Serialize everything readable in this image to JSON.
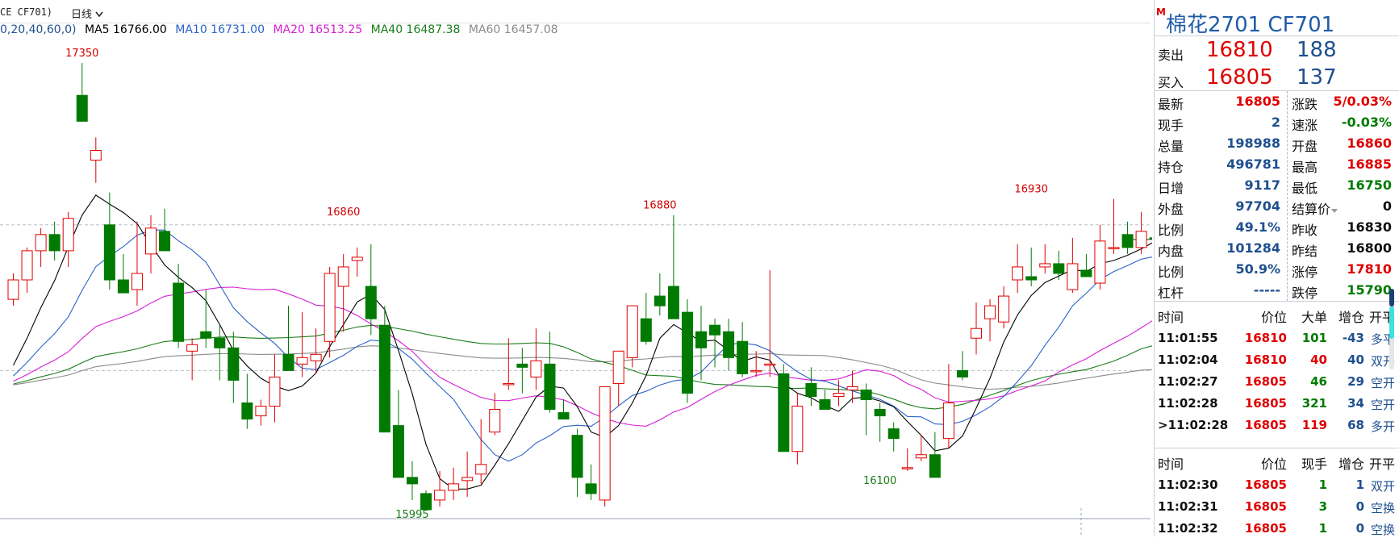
{
  "header": {
    "symbol_partial": "CE CF701)",
    "period": "日线",
    "period_icon": "chevron-down-icon"
  },
  "ma_legend": {
    "params": "0,20,40,60,0)",
    "items": [
      {
        "label": "MA5 16766.00",
        "color": "#000000"
      },
      {
        "label": "MA10 16731.00",
        "color": "#2a63c7"
      },
      {
        "label": "MA20 16513.25",
        "color": "#d61fd6"
      },
      {
        "label": "MA40 16487.38",
        "color": "#1a7d1a"
      },
      {
        "label": "MA60 16457.08",
        "color": "#8a8a8a"
      }
    ]
  },
  "chart_data": {
    "type": "candlestick",
    "title": "",
    "ylim": [
      15950,
      17420
    ],
    "reference_lines": [
      16850,
      16400
    ],
    "colors": {
      "up": "#e00000",
      "down": "#007a00",
      "ma5": "#000000",
      "ma10": "#2a63c7",
      "ma20": "#d61fd6",
      "ma40": "#1a7d1a",
      "ma60": "#8a8a8a"
    },
    "annotations": [
      {
        "text": "17350",
        "index": 5,
        "value": 17350,
        "color": "#d10000"
      },
      {
        "text": "16860",
        "index": 24,
        "value": 16860,
        "color": "#d10000"
      },
      {
        "text": "16880",
        "index": 47,
        "value": 16880,
        "color": "#d10000"
      },
      {
        "text": "15995",
        "index": 29,
        "value": 15995,
        "color": "#1a7d1a"
      },
      {
        "text": "16100",
        "index": 63,
        "value": 16100,
        "color": "#1a7d1a"
      },
      {
        "text": "16930",
        "index": 74,
        "value": 16930,
        "color": "#d10000"
      }
    ],
    "candles": [
      [
        16620,
        16700,
        16600,
        16680
      ],
      [
        16680,
        16780,
        16640,
        16770
      ],
      [
        16770,
        16840,
        16720,
        16820
      ],
      [
        16820,
        16860,
        16740,
        16770
      ],
      [
        16770,
        16890,
        16720,
        16870
      ],
      [
        17250,
        17350,
        17200,
        17170
      ],
      [
        17050,
        17120,
        16980,
        17080
      ],
      [
        16850,
        16950,
        16650,
        16680
      ],
      [
        16680,
        16760,
        16640,
        16640
      ],
      [
        16650,
        16860,
        16600,
        16700
      ],
      [
        16760,
        16880,
        16700,
        16840
      ],
      [
        16830,
        16900,
        16780,
        16770
      ],
      [
        16670,
        16730,
        16470,
        16490
      ],
      [
        16460,
        16500,
        16370,
        16480
      ],
      [
        16520,
        16650,
        16470,
        16500
      ],
      [
        16500,
        16540,
        16370,
        16470
      ],
      [
        16470,
        16520,
        16300,
        16370
      ],
      [
        16300,
        16390,
        16220,
        16250
      ],
      [
        16260,
        16310,
        16230,
        16290
      ],
      [
        16290,
        16450,
        16240,
        16380
      ],
      [
        16450,
        16600,
        16400,
        16400
      ],
      [
        16420,
        16580,
        16380,
        16440
      ],
      [
        16430,
        16530,
        16390,
        16450
      ],
      [
        16490,
        16720,
        16440,
        16700
      ],
      [
        16660,
        16760,
        16520,
        16720
      ],
      [
        16740,
        16780,
        16690,
        16750
      ],
      [
        16660,
        16790,
        16510,
        16560
      ],
      [
        16540,
        16600,
        16210,
        16210
      ],
      [
        16230,
        16340,
        16080,
        16070
      ],
      [
        16070,
        16120,
        16000,
        16050
      ],
      [
        16020,
        16030,
        15995,
        15970
      ],
      [
        16000,
        16090,
        15980,
        16030
      ],
      [
        16030,
        16100,
        16000,
        16050
      ],
      [
        16060,
        16150,
        16010,
        16070
      ],
      [
        16080,
        16250,
        16050,
        16110
      ],
      [
        16210,
        16330,
        16200,
        16280
      ],
      [
        16360,
        16500,
        16340,
        16360
      ],
      [
        16420,
        16470,
        16330,
        16410
      ],
      [
        16380,
        16530,
        16340,
        16430
      ],
      [
        16420,
        16520,
        16270,
        16280
      ],
      [
        16270,
        16310,
        16250,
        16250
      ],
      [
        16200,
        16220,
        16010,
        16070
      ],
      [
        16050,
        16110,
        16000,
        16020
      ],
      [
        16000,
        16280,
        15980,
        16350
      ],
      [
        16360,
        16400,
        16290,
        16460
      ],
      [
        16440,
        16600,
        16410,
        16600
      ],
      [
        16560,
        16640,
        16480,
        16490
      ],
      [
        16630,
        16700,
        16570,
        16600
      ],
      [
        16660,
        16880,
        16630,
        16560
      ],
      [
        16580,
        16620,
        16300,
        16330
      ],
      [
        16520,
        16600,
        16370,
        16470
      ],
      [
        16540,
        16560,
        16410,
        16510
      ],
      [
        16520,
        16560,
        16400,
        16440
      ],
      [
        16490,
        16550,
        16380,
        16390
      ],
      [
        16400,
        16460,
        16380,
        16400
      ],
      [
        16420,
        16710,
        16380,
        16420
      ],
      [
        16390,
        16420,
        16160,
        16150
      ],
      [
        16150,
        16330,
        16110,
        16290
      ],
      [
        16360,
        16410,
        16290,
        16320
      ],
      [
        16310,
        16340,
        16280,
        16280
      ],
      [
        16320,
        16370,
        16290,
        16330
      ],
      [
        16340,
        16400,
        16300,
        16350
      ],
      [
        16340,
        16360,
        16200,
        16310
      ],
      [
        16280,
        16300,
        16180,
        16260
      ],
      [
        16220,
        16240,
        16150,
        16190
      ],
      [
        16100,
        16160,
        16090,
        16100
      ],
      [
        16130,
        16200,
        16120,
        16140
      ],
      [
        16140,
        16210,
        16120,
        16070
      ],
      [
        16190,
        16420,
        16160,
        16300
      ],
      [
        16400,
        16460,
        16370,
        16380
      ],
      [
        16500,
        16610,
        16450,
        16530
      ],
      [
        16560,
        16620,
        16490,
        16600
      ],
      [
        16550,
        16660,
        16530,
        16630
      ],
      [
        16680,
        16790,
        16640,
        16720
      ],
      [
        16690,
        16780,
        16660,
        16680
      ],
      [
        16720,
        16790,
        16700,
        16730
      ],
      [
        16730,
        16770,
        16680,
        16700
      ],
      [
        16650,
        16810,
        16640,
        16730
      ],
      [
        16710,
        16760,
        16690,
        16690
      ],
      [
        16670,
        16850,
        16650,
        16800
      ],
      [
        16780,
        16930,
        16760,
        16780
      ],
      [
        16820,
        16860,
        16760,
        16780
      ],
      [
        16780,
        16890,
        16760,
        16830
      ],
      [
        16810,
        16870,
        16780,
        16805
      ]
    ]
  },
  "panel": {
    "m_badge": "M",
    "title": "棉花2701 CF701",
    "sell": {
      "label": "卖出",
      "price": "16810",
      "volume": "188"
    },
    "buy": {
      "label": "买入",
      "price": "16805",
      "volume": "137"
    },
    "quote_left": [
      {
        "label": "最新",
        "value": "16805",
        "color": "#e00000"
      },
      {
        "label": "现手",
        "value": "2",
        "color": "#1f4f8f"
      },
      {
        "label": "总量",
        "value": "198988",
        "color": "#1f4f8f"
      },
      {
        "label": "持仓",
        "value": "496781",
        "color": "#1f4f8f"
      },
      {
        "label": "日增",
        "value": "9117",
        "color": "#1f4f8f"
      },
      {
        "label": "外盘",
        "value": "97704",
        "color": "#1f4f8f"
      },
      {
        "label": "比例",
        "value": "49.1%",
        "color": "#1f4f8f"
      },
      {
        "label": "内盘",
        "value": "101284",
        "color": "#1f4f8f"
      },
      {
        "label": "比例",
        "value": "50.9%",
        "color": "#1f4f8f"
      },
      {
        "label": "杠杆",
        "value": "-----",
        "color": "#1f4f8f"
      }
    ],
    "quote_right": [
      {
        "label": "涨跌",
        "value": "5/0.03%",
        "color": "#e00000"
      },
      {
        "label": "速涨",
        "value": "-0.03%",
        "color": "#007a00"
      },
      {
        "label": "开盘",
        "value": "16860",
        "color": "#e00000"
      },
      {
        "label": "最高",
        "value": "16885",
        "color": "#e00000"
      },
      {
        "label": "最低",
        "value": "16750",
        "color": "#007a00"
      },
      {
        "label": "结算价",
        "value": "0",
        "color": "#111111"
      },
      {
        "label": "昨收",
        "value": "16830",
        "color": "#111111"
      },
      {
        "label": "昨结",
        "value": "16800",
        "color": "#111111"
      },
      {
        "label": "涨停",
        "value": "17810",
        "color": "#e00000"
      },
      {
        "label": "跌停",
        "value": "15790",
        "color": "#007a00"
      }
    ],
    "table1": {
      "headers": [
        "时间",
        "价位",
        "大单",
        "增仓",
        "开平"
      ],
      "rows": [
        {
          "time": "11:01:55",
          "price": "16810",
          "big": "101",
          "chg": "-43",
          "type": "多平"
        },
        {
          "time": "11:02:04",
          "price": "16810",
          "big": "40",
          "chg": "40",
          "type": "双开"
        },
        {
          "time": "11:02:27",
          "price": "16805",
          "big": "46",
          "chg": "29",
          "type": "空开"
        },
        {
          "time": "11:02:28",
          "price": "16805",
          "big": "321",
          "chg": "34",
          "type": "空开"
        },
        {
          "time": ">11:02:28",
          "price": "16805",
          "big": "119",
          "chg": "68",
          "type": "多开"
        }
      ]
    },
    "table2": {
      "headers": [
        "时间",
        "价位",
        "现手",
        "增仓",
        "开平"
      ],
      "rows": [
        {
          "time": "11:02:30",
          "price": "16805",
          "hand": "1",
          "chg": "1",
          "type": "双开"
        },
        {
          "time": "11:02:31",
          "price": "16805",
          "hand": "3",
          "chg": "0",
          "type": "空换"
        },
        {
          "time": "11:02:32",
          "price": "16805",
          "hand": "1",
          "chg": "0",
          "type": "空换"
        }
      ]
    }
  }
}
